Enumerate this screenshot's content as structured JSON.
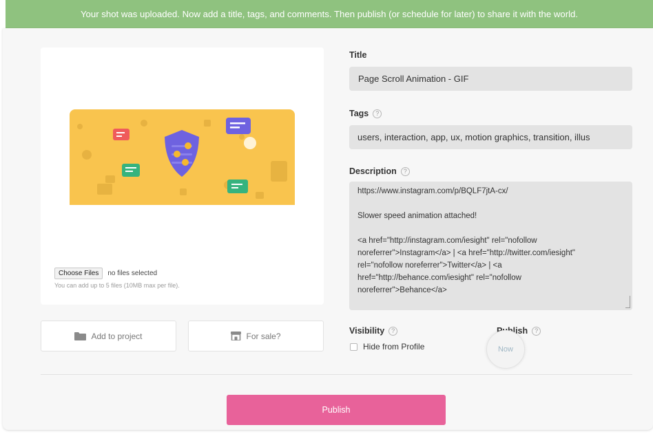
{
  "banner": {
    "message": "Your shot was uploaded. Now add a title, tags, and comments. Then publish (or schedule for later) to share it with the world.",
    "color": "#8fc27f"
  },
  "upload": {
    "choose_label": "Choose Files",
    "status": "no files selected",
    "hint": "You can add up to 5 files (10MB max per file).",
    "preview_bg": "#f9c44e",
    "shield_color": "#6e62e0"
  },
  "actions": {
    "add_to_project": "Add to project",
    "for_sale": "For sale?",
    "folder_icon": "folder-icon",
    "store_icon": "store-icon"
  },
  "form": {
    "title_label": "Title",
    "title_value": "Page Scroll Animation - GIF",
    "tags_label": "Tags",
    "tags_value": "users, interaction, app, ux, motion graphics, transition, illus",
    "description_label": "Description",
    "description_lines": [
      "https://www.instagram.com/p/BQLF7jtA-cx/",
      "",
      "Slower speed animation attached!",
      "",
      "<a href=\"http://instagram.com/iesight\" rel=\"nofollow",
      "noreferrer\">Instagram</a> | <a href=\"http://twitter.com/iesight\"",
      "rel=\"nofollow noreferrer\">Twitter</a> | <a",
      "href=\"http://behance.com/iesight\" rel=\"nofollow",
      "noreferrer\">Behance</a>"
    ],
    "help_glyph": "?"
  },
  "visibility": {
    "label": "Visibility",
    "hide_label": "Hide from Profile"
  },
  "publish": {
    "label": "Publish",
    "now": "Now",
    "button": "Publish",
    "button_color": "#e8629a"
  }
}
